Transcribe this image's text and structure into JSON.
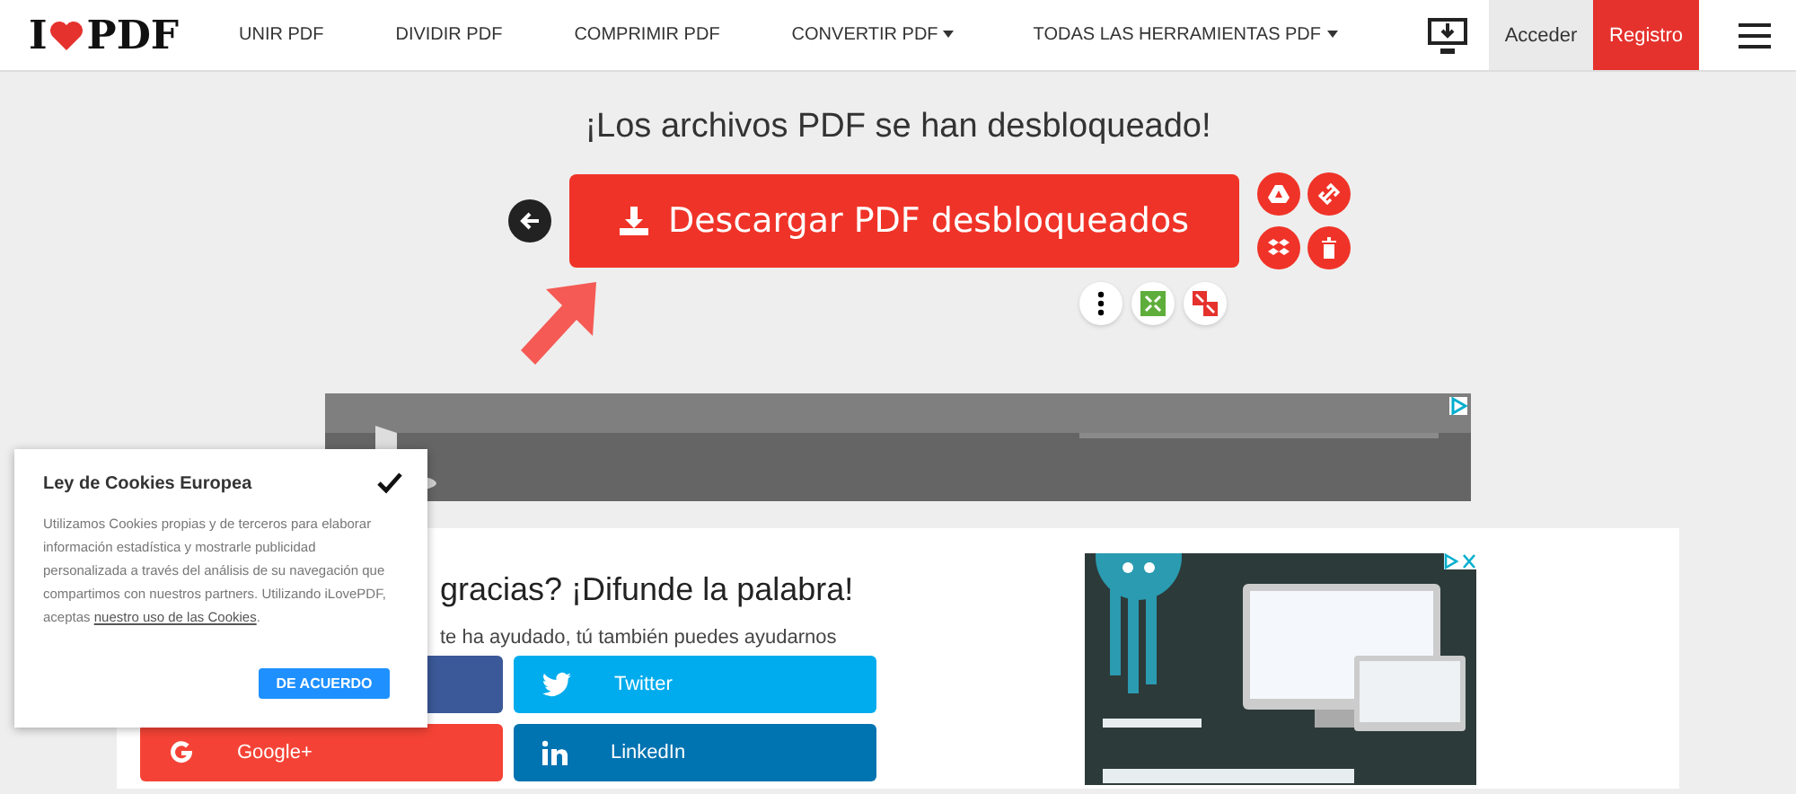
{
  "navbar": {
    "logo": {
      "left": "I",
      "right": "PDF"
    },
    "items": [
      {
        "label": "UNIR PDF",
        "dropdown": false
      },
      {
        "label": "DIVIDIR PDF",
        "dropdown": false
      },
      {
        "label": "COMPRIMIR PDF",
        "dropdown": false
      },
      {
        "label": "CONVERTIR PDF",
        "dropdown": true
      },
      {
        "label": "TODAS LAS HERRAMIENTAS PDF",
        "dropdown": true
      }
    ],
    "login": "Acceder",
    "signup": "Registro"
  },
  "result": {
    "title": "¡Los archivos PDF se han desbloqueado!",
    "download_button": "Descargar PDF desbloqueados"
  },
  "share": {
    "heading": "gracias? ¡Difunde la palabra!",
    "subtitle": "te ha ayudado, tú también puedes ayudarnos",
    "buttons": [
      {
        "kind": "facebook"
      },
      {
        "kind": "twitter",
        "label": "Twitter"
      },
      {
        "kind": "google",
        "label": "Google+"
      },
      {
        "kind": "linkedin",
        "label": "LinkedIn"
      }
    ]
  },
  "cookie_popup": {
    "title": "Ley de Cookies Europea",
    "text": "Utilizamos Cookies propias y de terceros para elaborar información estadística y mostrarle publicidad personalizada a través del análisis de su navegación que compartimos con nuestros partners. Utilizando iLovePDF, aceptas",
    "link": "nuestro uso de las Cookies",
    "after_link": ".",
    "accept": "DE ACUERDO"
  }
}
